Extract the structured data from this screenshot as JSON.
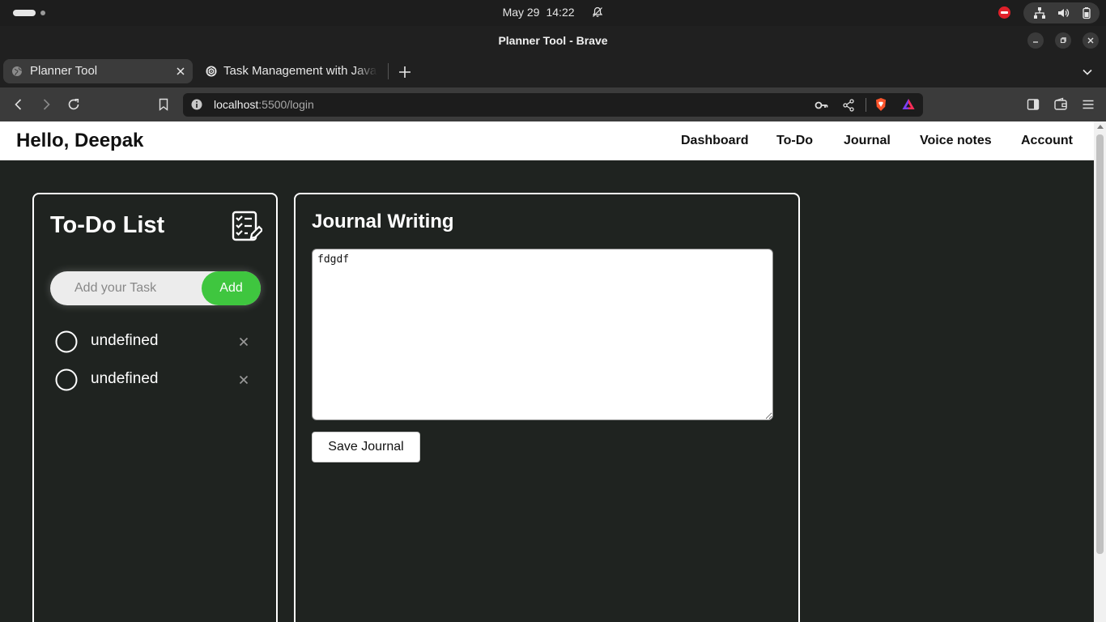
{
  "os": {
    "date": "May 29",
    "time": "14:22"
  },
  "window": {
    "title": "Planner Tool - Brave"
  },
  "tabs": [
    {
      "label": "Planner Tool",
      "active": true
    },
    {
      "label": "Task Management with JavaScript",
      "active": false
    }
  ],
  "omnibox": {
    "host": "localhost",
    "path": ":5500/login"
  },
  "site": {
    "greeting": "Hello, Deepak",
    "nav": [
      "Dashboard",
      "To-Do",
      "Journal",
      "Voice notes",
      "Account"
    ]
  },
  "todo": {
    "title": "To-Do List",
    "input_placeholder": "Add your Task",
    "input_value": "",
    "add_label": "Add",
    "tasks": [
      {
        "text": "undefined",
        "done": false
      },
      {
        "text": "undefined",
        "done": false
      }
    ]
  },
  "journal": {
    "title": "Journal Writing",
    "text": "fdgdf",
    "save_label": "Save Journal"
  },
  "colors": {
    "page_bg": "#1f2320",
    "accent_green": "#3fc63f",
    "browser_dark": "#202020",
    "toolbar": "#3b3b3b"
  }
}
